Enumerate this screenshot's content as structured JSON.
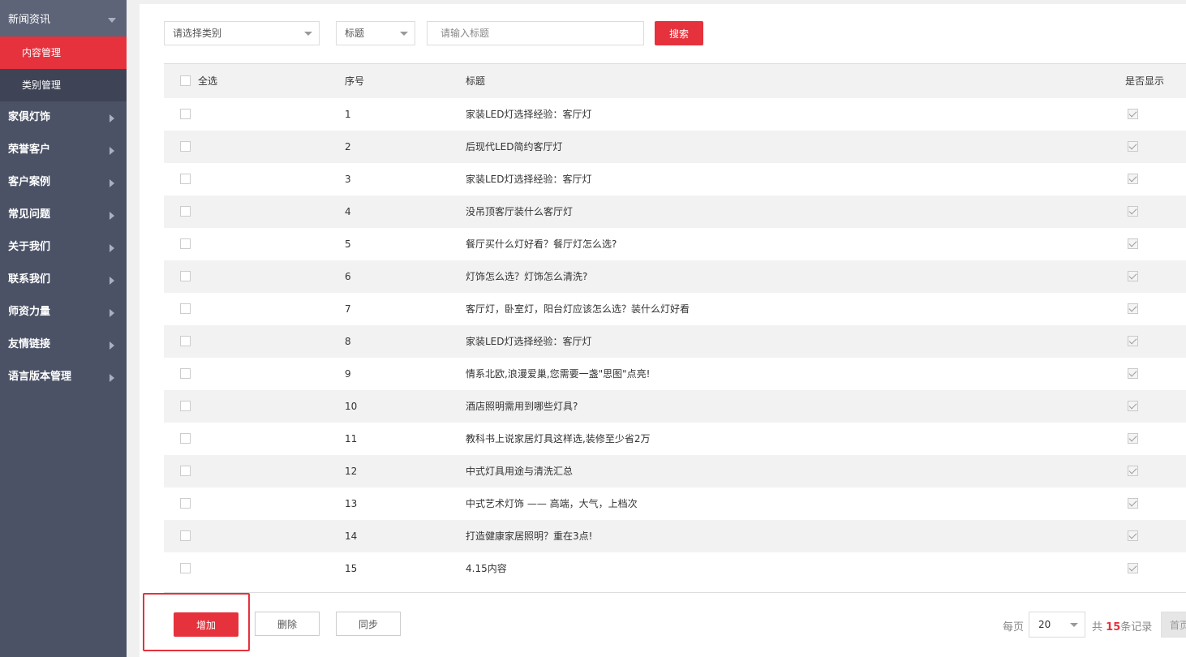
{
  "sidebar": {
    "expanded": {
      "label": "新闻资讯",
      "icon": "chevron-down-icon"
    },
    "submenu": [
      {
        "label": "内容管理",
        "active": true
      },
      {
        "label": "类别管理",
        "active": false
      }
    ],
    "items": [
      {
        "label": "家俱灯饰"
      },
      {
        "label": "荣誉客户"
      },
      {
        "label": "客户案例"
      },
      {
        "label": "常见问题"
      },
      {
        "label": "关于我们"
      },
      {
        "label": "联系我们"
      },
      {
        "label": "师资力量"
      },
      {
        "label": "友情链接"
      },
      {
        "label": "语言版本管理"
      }
    ]
  },
  "toolbar": {
    "category_select": "请选择类别",
    "field_select": "标题",
    "search_placeholder": "请输入标题",
    "search_label": "搜索"
  },
  "table": {
    "headers": {
      "select_all": "全选",
      "index": "序号",
      "title": "标题",
      "visible": "是否显示"
    },
    "rows": [
      {
        "index": "1",
        "title": "家装LED灯选择经验：客厅灯",
        "visible": true
      },
      {
        "index": "2",
        "title": "后现代LED简约客厅灯",
        "visible": true
      },
      {
        "index": "3",
        "title": "家装LED灯选择经验：客厅灯",
        "visible": true
      },
      {
        "index": "4",
        "title": "没吊顶客厅装什么客厅灯",
        "visible": true
      },
      {
        "index": "5",
        "title": "餐厅买什么灯好看？餐厅灯怎么选?",
        "visible": true
      },
      {
        "index": "6",
        "title": "灯饰怎么选？灯饰怎么清洗?",
        "visible": true
      },
      {
        "index": "7",
        "title": "客厅灯，卧室灯，阳台灯应该怎么选？装什么灯好看",
        "visible": true
      },
      {
        "index": "8",
        "title": "家装LED灯选择经验：客厅灯",
        "visible": true
      },
      {
        "index": "9",
        "title": "情系北欧,浪漫爱巢,您需要一盏\"思图\"点亮!",
        "visible": true
      },
      {
        "index": "10",
        "title": "酒店照明需用到哪些灯具?",
        "visible": true
      },
      {
        "index": "11",
        "title": "教科书上说家居灯具这样选,装修至少省2万",
        "visible": true
      },
      {
        "index": "12",
        "title": "中式灯具用途与清洗汇总",
        "visible": true
      },
      {
        "index": "13",
        "title": "中式艺术灯饰 —— 高端，大气，上档次",
        "visible": true
      },
      {
        "index": "14",
        "title": "打造健康家居照明？重在3点!",
        "visible": true
      },
      {
        "index": "15",
        "title": "4.15内容",
        "visible": true
      }
    ]
  },
  "footer": {
    "add_label": "增加",
    "delete_label": "删除",
    "sync_label": "同步",
    "per_page_label": "每页",
    "per_page_value": "20",
    "total_prefix": "共",
    "total_count": "15",
    "total_suffix": "条记录",
    "first_page_label": "首页"
  },
  "colors": {
    "accent": "#e5323d",
    "sidebar_bg": "#4b5266"
  }
}
